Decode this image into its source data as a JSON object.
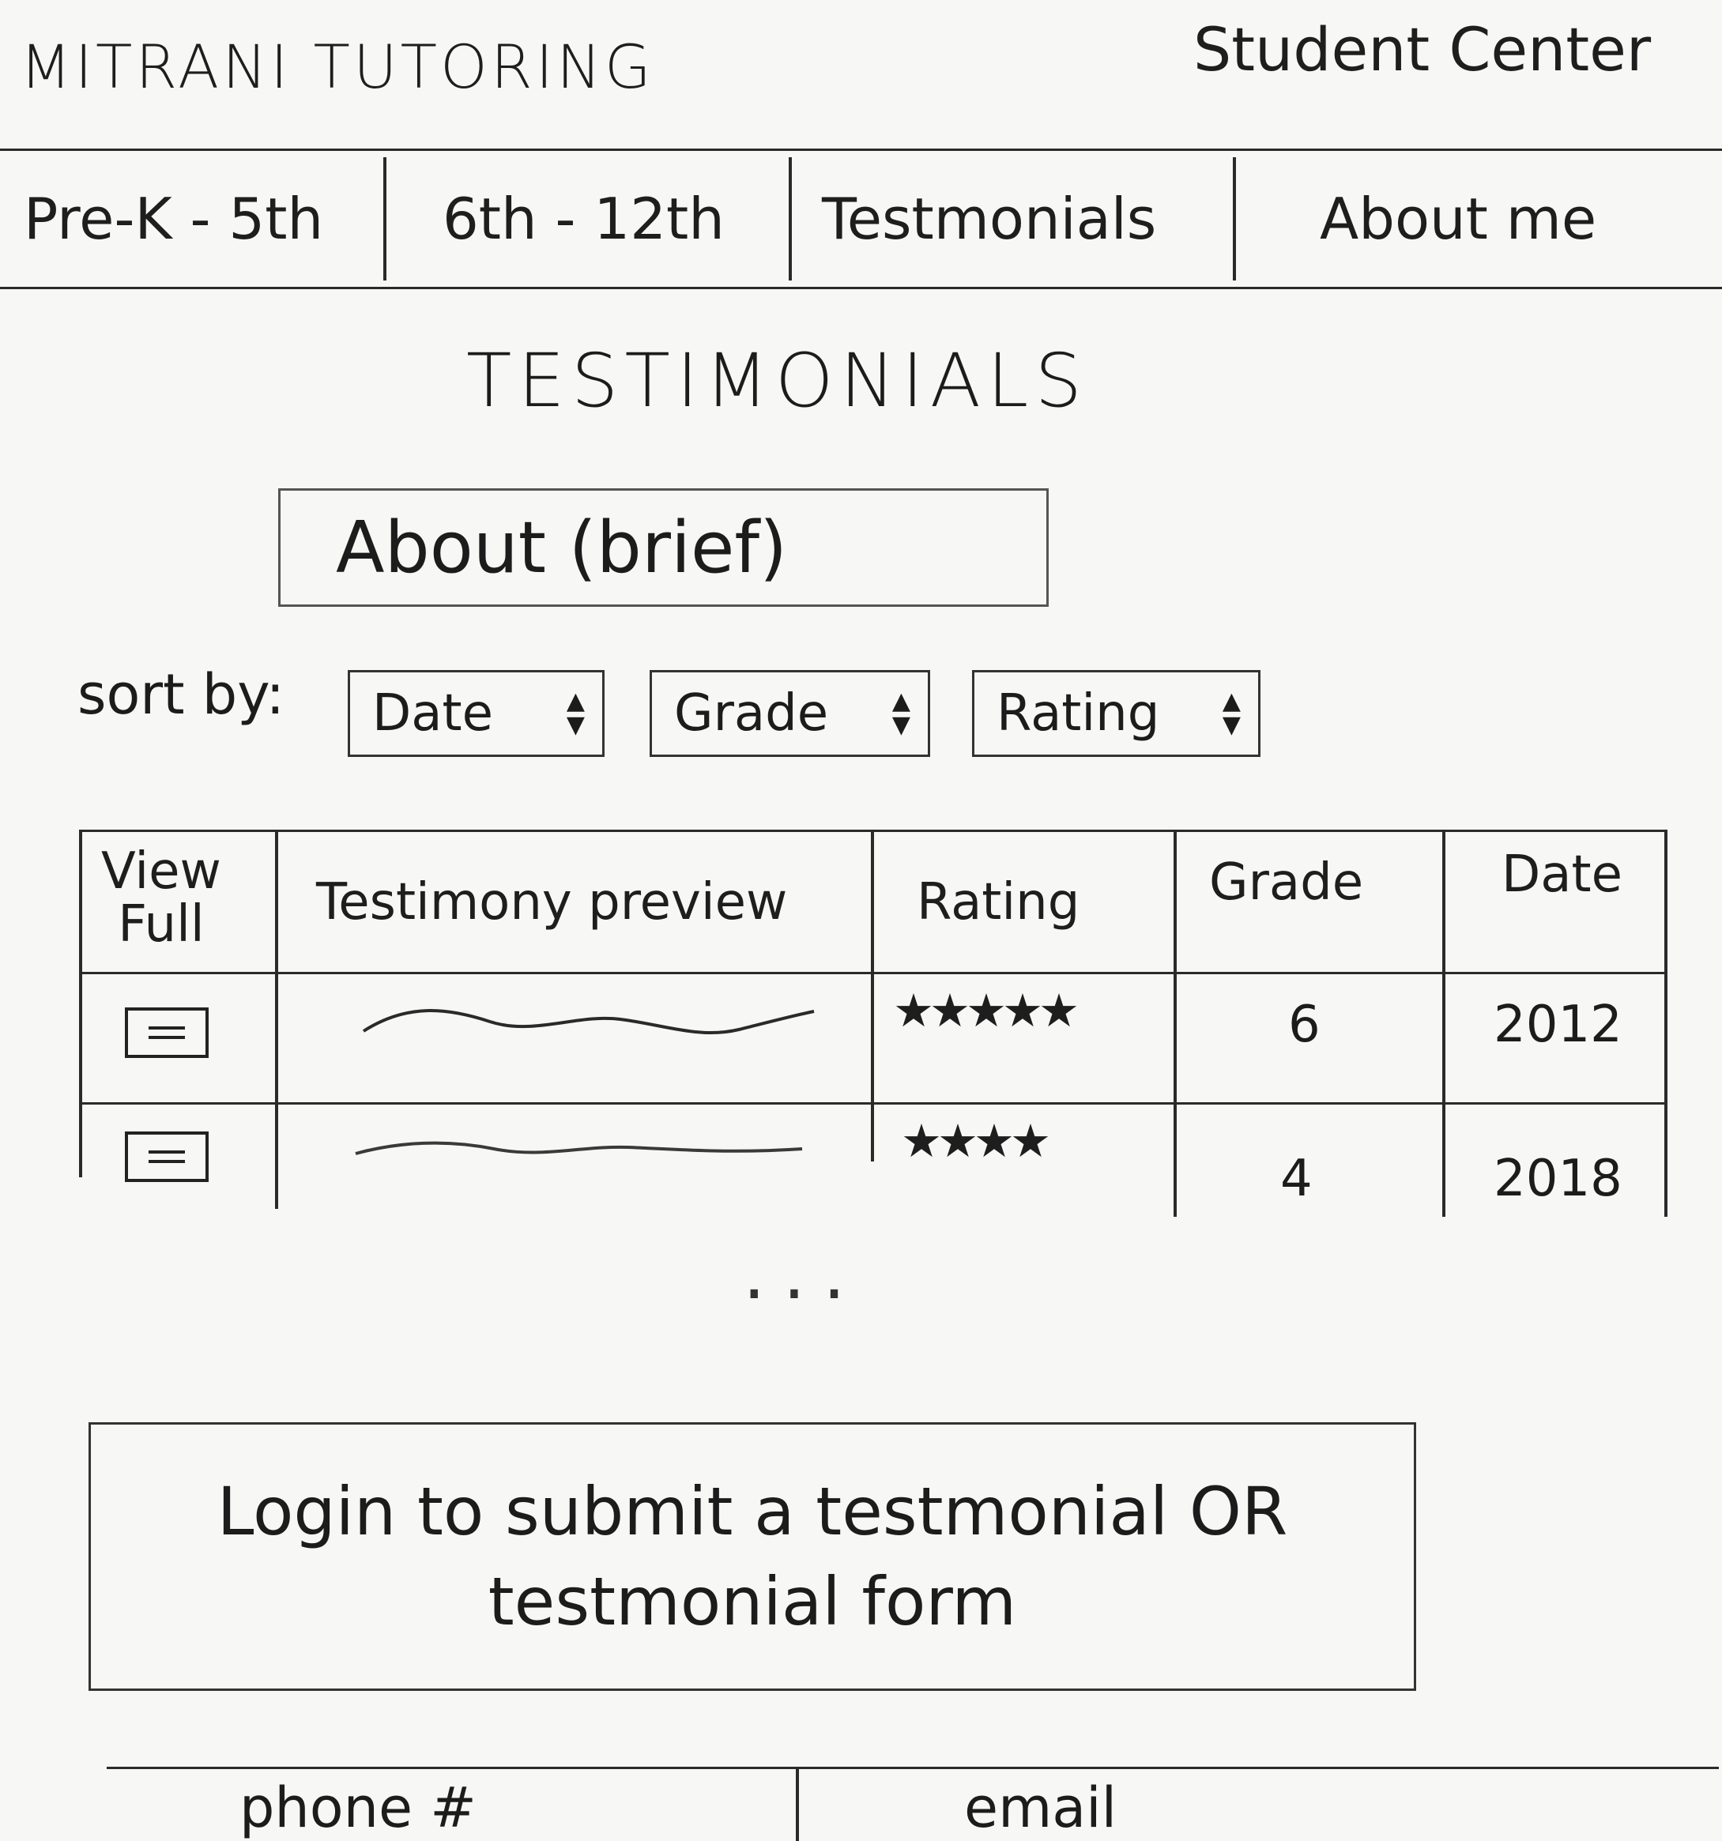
{
  "header": {
    "brand": "MITRANI TUTORING",
    "student_center": "Student Center"
  },
  "nav": {
    "items": [
      {
        "label": "Pre-K - 5th"
      },
      {
        "label": "6th - 12th"
      },
      {
        "label": "Testmonials"
      },
      {
        "label": "About me"
      }
    ]
  },
  "page": {
    "title": "TESTIMONIALS",
    "about": "About (brief)"
  },
  "sort": {
    "label": "sort by:",
    "options": [
      {
        "label": "Date"
      },
      {
        "label": "Grade"
      },
      {
        "label": "Rating"
      }
    ]
  },
  "table": {
    "headers": {
      "view_full_1": "View",
      "view_full_2": "Full",
      "preview": "Testimony preview",
      "rating": "Rating",
      "grade": "Grade",
      "date": "Date"
    },
    "rows": [
      {
        "stars": "★★★★★",
        "rating": 5,
        "grade": "6",
        "date": "2012"
      },
      {
        "stars": "★★★★",
        "rating": 4,
        "grade": "4",
        "date": "2018"
      }
    ],
    "more": "..."
  },
  "login": {
    "line1": "Login to submit a testmonial OR",
    "line2": "testmonial form"
  },
  "footer": {
    "phone": "phone #",
    "email": "email"
  }
}
